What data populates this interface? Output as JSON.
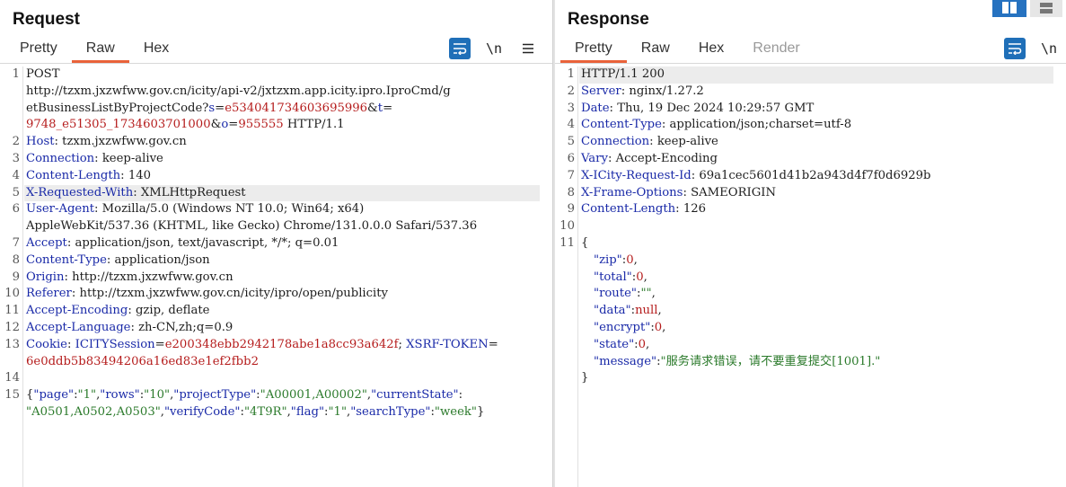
{
  "request": {
    "title": "Request",
    "tabs": [
      {
        "label": "Pretty",
        "active": false
      },
      {
        "label": "Raw",
        "active": true
      },
      {
        "label": "Hex",
        "active": false
      }
    ],
    "newline_label": "\\n",
    "wrap_icon": "wrap-lines-icon",
    "menu_icon": "hamburger-menu-icon",
    "line_numbers": [
      "1",
      "2",
      "3",
      "4",
      "5",
      "6",
      "7",
      "8",
      "9",
      "10",
      "11",
      "12",
      "13",
      "14",
      "15"
    ],
    "l1": "POST",
    "l1b_a": "http://tzxm.jxzwfww.gov.cn/icity/api-v2/jxtzxm.app.icity.ipro.IproCmd/g",
    "l1c_a": "etBusinessListByProjectCode?",
    "l1c_k1": "s",
    "l1c_v1": "e534041734603695996",
    "l1c_k2": "t",
    "l1d_v2": "9748_e51305_1734603701000",
    "l1d_k3": "o",
    "l1d_v3": "955555",
    "l1d_tail": " HTTP/1.1",
    "h2k": "Host",
    "h2v": "tzxm.jxzwfww.gov.cn",
    "h3k": "Connection",
    "h3v": "keep-alive",
    "h4k": "Content-Length",
    "h4v": "140",
    "h5k": "X-Requested-With",
    "h5v": "XMLHttpRequest",
    "h6k": "User-Agent",
    "h6v": "Mozilla/5.0 (Windows NT 10.0; Win64; x64)",
    "h6v2": "AppleWebKit/537.36 (KHTML, like Gecko) Chrome/131.0.0.0 Safari/537.36",
    "h7k": "Accept",
    "h7v": "application/json, text/javascript, */*; q=0.01",
    "h8k": "Content-Type",
    "h8v": "application/json",
    "h9k": "Origin",
    "h9v": "http://tzxm.jxzwfww.gov.cn",
    "h10k": "Referer",
    "h10v": "http://tzxm.jxzwfww.gov.cn/icity/ipro/open/publicity",
    "h11k": "Accept-Encoding",
    "h11v": "gzip, deflate",
    "h12k": "Accept-Language",
    "h12v": "zh-CN,zh;q=0.9",
    "h13k": "Cookie",
    "c1k": "ICITYSession",
    "c1v": "e200348ebb2942178abe1a8cc93a642f",
    "c2k": "XSRF-TOKEN",
    "c2v": "6e0ddb5b83494206a16ed83e1ef2fbb2",
    "b1": {
      "page_k": "\"page\"",
      "page_v": "\"1\"",
      "rows_k": "\"rows\"",
      "rows_v": "\"10\"",
      "pt_k": "\"projectType\"",
      "pt_v": "\"A00001,A00002\"",
      "cs_k": "\"currentState\""
    },
    "b2": {
      "cs_v": "\"A0501,A0502,A0503\"",
      "vc_k": "\"verifyCode\"",
      "vc_v": "\"4T9R\"",
      "fl_k": "\"flag\"",
      "fl_v": "\"1\"",
      "st_k": "\"searchType\"",
      "st_v": "\"week\""
    }
  },
  "response": {
    "title": "Response",
    "tabs": [
      {
        "label": "Pretty",
        "active": true
      },
      {
        "label": "Raw",
        "active": false
      },
      {
        "label": "Hex",
        "active": false
      },
      {
        "label": "Render",
        "active": false
      }
    ],
    "newline_label": "\\n",
    "line_numbers": [
      "1",
      "2",
      "3",
      "4",
      "5",
      "6",
      "7",
      "8",
      "9",
      "10",
      "11"
    ],
    "status": "HTTP/1.1 200",
    "headers": [
      {
        "k": "Server",
        "v": "nginx/1.27.2"
      },
      {
        "k": "Date",
        "v": "Thu, 19 Dec 2024 10:29:57 GMT"
      },
      {
        "k": "Content-Type",
        "v": "application/json;charset=utf-8"
      },
      {
        "k": "Connection",
        "v": "keep-alive"
      },
      {
        "k": "Vary",
        "v": "Accept-Encoding"
      },
      {
        "k": "X-ICity-Request-Id",
        "v": "69a1cec5601d41b2a943d4f7f0d6929b"
      },
      {
        "k": "X-Frame-Options",
        "v": "SAMEORIGIN"
      },
      {
        "k": "Content-Length",
        "v": "126"
      }
    ],
    "json_open": "{",
    "json_close": "}",
    "json": [
      {
        "k": "\"zip\"",
        "v": "0"
      },
      {
        "k": "\"total\"",
        "v": "0"
      },
      {
        "k": "\"route\"",
        "v": "\"\""
      },
      {
        "k": "\"data\"",
        "v": "null"
      },
      {
        "k": "\"encrypt\"",
        "v": "0"
      },
      {
        "k": "\"state\"",
        "v": "0"
      },
      {
        "k": "\"message\"",
        "v": "\"服务请求错误，请不要重复提交[1001].\""
      }
    ]
  },
  "colors": {
    "accent": "#e9623a",
    "button_blue": "#1f6fb8",
    "key": "#1a2aa8",
    "value": "#b51c1c",
    "json_string": "#2b7a2b"
  }
}
